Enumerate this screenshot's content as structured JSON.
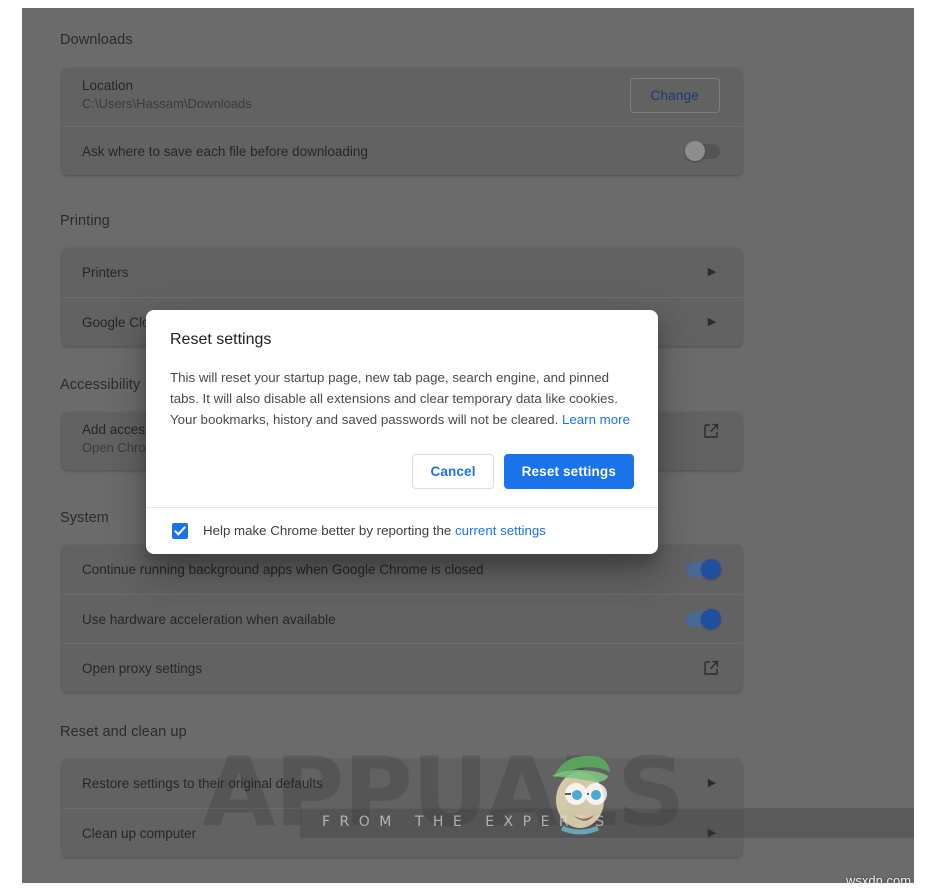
{
  "page": {
    "sections": [
      {
        "id": "downloads",
        "title": "Downloads",
        "rows": [
          {
            "label": "Location",
            "sub": "C:\\Users\\Hassam\\Downloads",
            "control": "button",
            "button_label": "Change"
          },
          {
            "label": "Ask where to save each file before downloading",
            "control": "toggle",
            "toggle_state": "off"
          }
        ]
      },
      {
        "id": "printing",
        "title": "Printing",
        "rows": [
          {
            "label": "Printers",
            "control": "chevron",
            "icon": "chevron-right-icon"
          },
          {
            "label": "Google Clo",
            "control": "chevron",
            "icon": "chevron-right-icon"
          }
        ]
      },
      {
        "id": "accessibility",
        "title": "Accessibility",
        "rows": [
          {
            "label": "Add access",
            "sub": "Open Chro",
            "control": "external",
            "icon": "external-link-icon"
          }
        ]
      },
      {
        "id": "system",
        "title": "System",
        "rows": [
          {
            "label": "Continue running background apps when Google Chrome is closed",
            "control": "toggle",
            "toggle_state": "on"
          },
          {
            "label": "Use hardware acceleration when available",
            "control": "toggle",
            "toggle_state": "on"
          },
          {
            "label": "Open proxy settings",
            "control": "external",
            "icon": "external-link-icon"
          }
        ]
      },
      {
        "id": "reset-and-clean-up",
        "title": "Reset and clean up",
        "rows": [
          {
            "label": "Restore settings to their original defaults",
            "control": "chevron",
            "icon": "chevron-right-icon"
          },
          {
            "label": "Clean up computer",
            "control": "chevron",
            "icon": "chevron-right-icon"
          }
        ]
      }
    ]
  },
  "dialog": {
    "title": "Reset settings",
    "body_text": "This will reset your startup page, new tab page, search engine, and pinned tabs. It will also disable all extensions and clear temporary data like cookies. Your bookmarks, history and saved passwords will not be cleared. ",
    "learn_more_label": "Learn more",
    "cancel_label": "Cancel",
    "confirm_label": "Reset settings",
    "footer_text": "Help make Chrome better by reporting the ",
    "footer_link_label": "current settings",
    "checkbox_state": "checked"
  },
  "watermark": {
    "word": "APPUALS",
    "band_text": "FROM THE EXPERTS",
    "credit": "wsxdn.com"
  },
  "colors": {
    "accent_blue": "#1a73e8",
    "scrim_gray": "#6b6b6b",
    "card_gray": "#626262",
    "toggle_on": "#1f4f9e"
  }
}
